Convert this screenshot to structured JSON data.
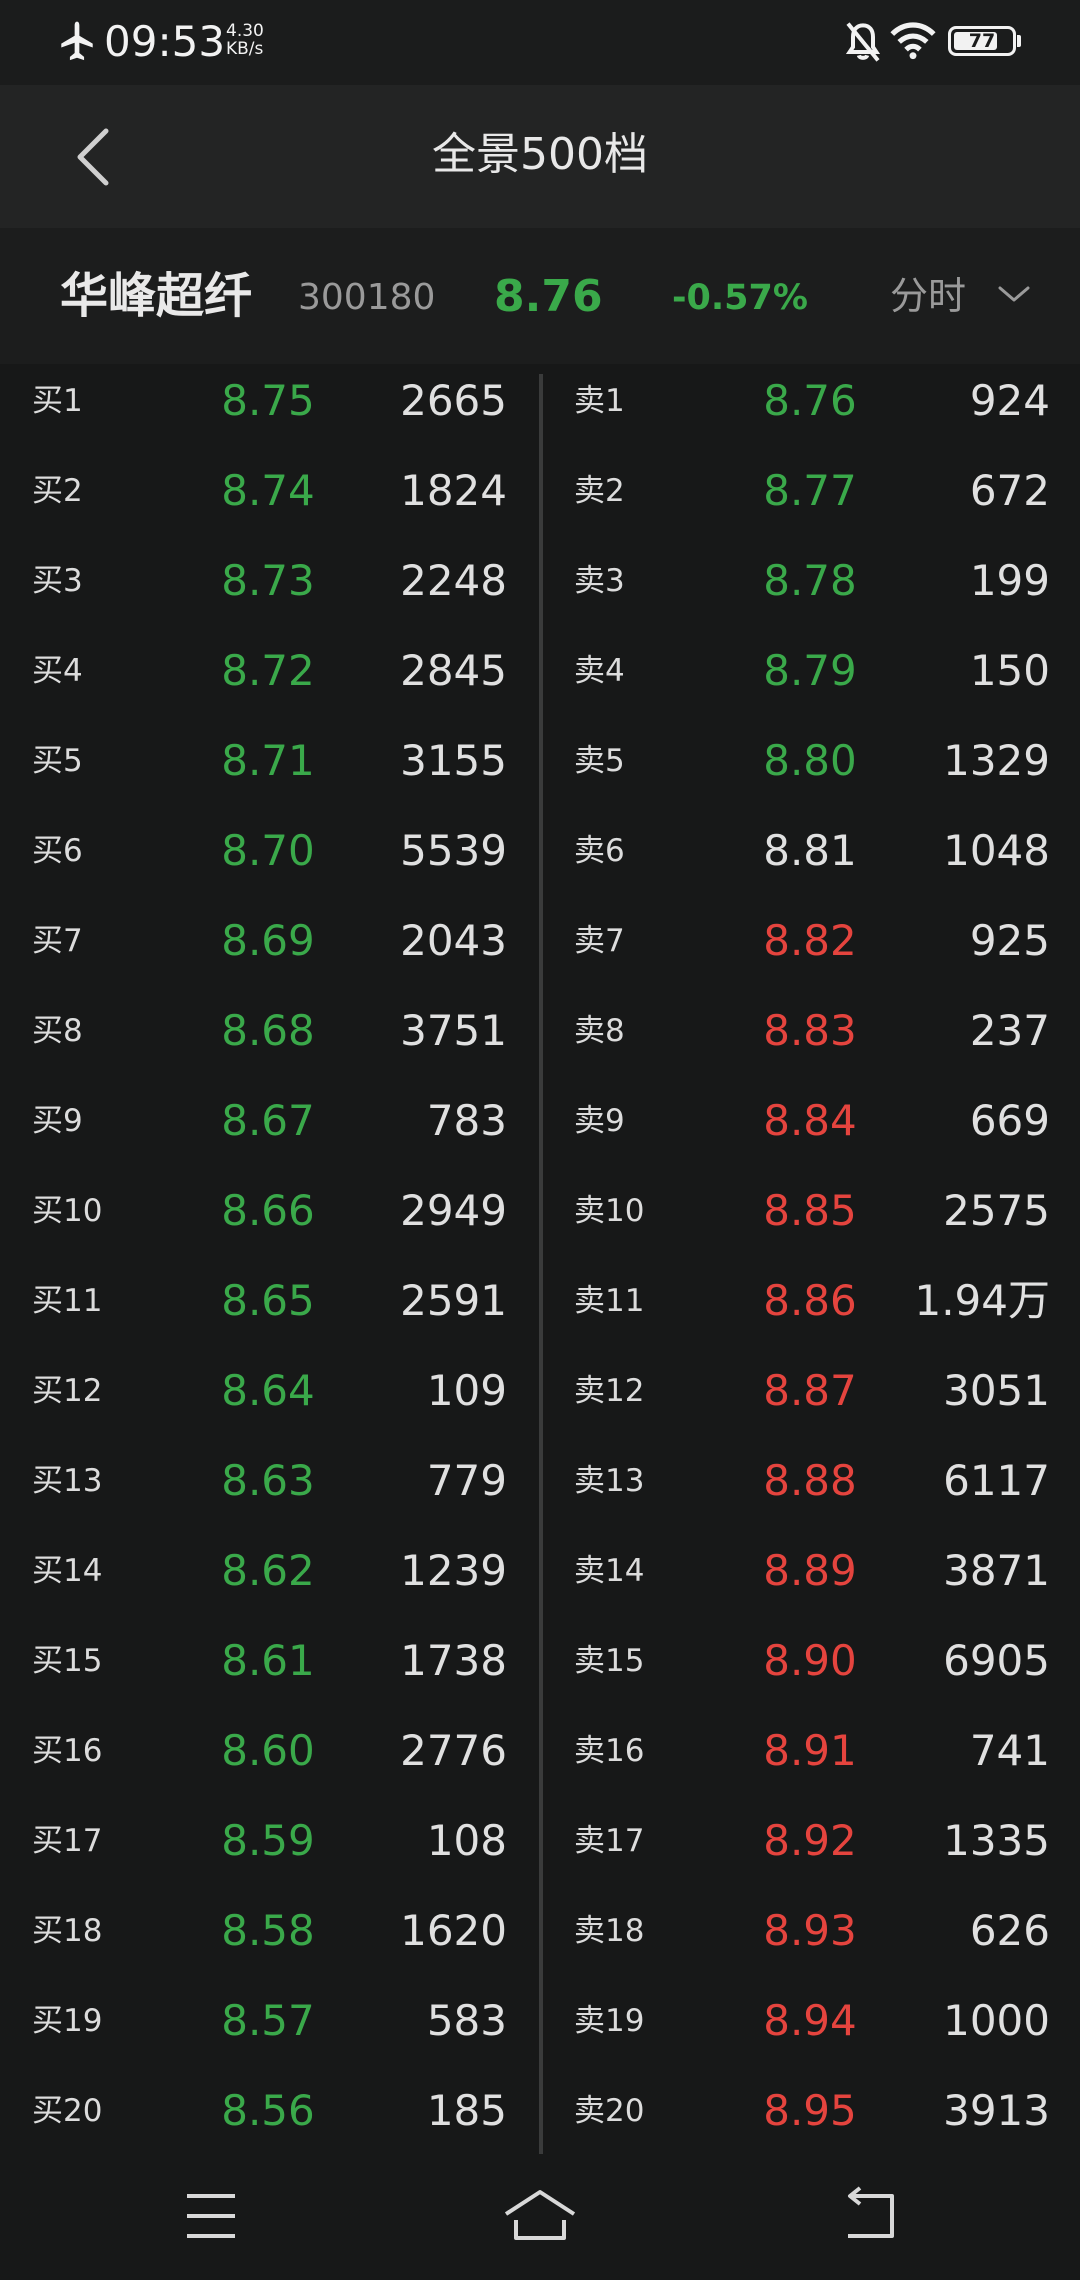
{
  "status_bar": {
    "time": "09:53",
    "net_speed_value": "4.30",
    "net_speed_unit": "KB/s",
    "battery": "77",
    "battery_level": 0.77,
    "icons": [
      "airplane-mode-icon",
      "notifications-muted-icon",
      "wifi-icon",
      "battery-icon"
    ]
  },
  "header": {
    "title": "全景500档",
    "back_icon": "chevron-left-icon"
  },
  "stock": {
    "name": "华峰超纤",
    "code": "300180",
    "price": "8.76",
    "change_pct": "-0.57%",
    "period": "分时",
    "period_icon": "chevron-down-icon"
  },
  "colors": {
    "down_green": "#3aa94a",
    "up_red": "#e5443e",
    "neutral": "#e0e0e0"
  },
  "bids": [
    {
      "label": "买1",
      "price": "8.75",
      "volume": "2665",
      "dir": "down"
    },
    {
      "label": "买2",
      "price": "8.74",
      "volume": "1824",
      "dir": "down"
    },
    {
      "label": "买3",
      "price": "8.73",
      "volume": "2248",
      "dir": "down"
    },
    {
      "label": "买4",
      "price": "8.72",
      "volume": "2845",
      "dir": "down"
    },
    {
      "label": "买5",
      "price": "8.71",
      "volume": "3155",
      "dir": "down"
    },
    {
      "label": "买6",
      "price": "8.70",
      "volume": "5539",
      "dir": "down"
    },
    {
      "label": "买7",
      "price": "8.69",
      "volume": "2043",
      "dir": "down"
    },
    {
      "label": "买8",
      "price": "8.68",
      "volume": "3751",
      "dir": "down"
    },
    {
      "label": "买9",
      "price": "8.67",
      "volume": "783",
      "dir": "down"
    },
    {
      "label": "买10",
      "price": "8.66",
      "volume": "2949",
      "dir": "down"
    },
    {
      "label": "买11",
      "price": "8.65",
      "volume": "2591",
      "dir": "down"
    },
    {
      "label": "买12",
      "price": "8.64",
      "volume": "109",
      "dir": "down"
    },
    {
      "label": "买13",
      "price": "8.63",
      "volume": "779",
      "dir": "down"
    },
    {
      "label": "买14",
      "price": "8.62",
      "volume": "1239",
      "dir": "down"
    },
    {
      "label": "买15",
      "price": "8.61",
      "volume": "1738",
      "dir": "down"
    },
    {
      "label": "买16",
      "price": "8.60",
      "volume": "2776",
      "dir": "down"
    },
    {
      "label": "买17",
      "price": "8.59",
      "volume": "108",
      "dir": "down"
    },
    {
      "label": "买18",
      "price": "8.58",
      "volume": "1620",
      "dir": "down"
    },
    {
      "label": "买19",
      "price": "8.57",
      "volume": "583",
      "dir": "down"
    },
    {
      "label": "买20",
      "price": "8.56",
      "volume": "185",
      "dir": "down"
    }
  ],
  "asks": [
    {
      "label": "卖1",
      "price": "8.76",
      "volume": "924",
      "dir": "down"
    },
    {
      "label": "卖2",
      "price": "8.77",
      "volume": "672",
      "dir": "down"
    },
    {
      "label": "卖3",
      "price": "8.78",
      "volume": "199",
      "dir": "down"
    },
    {
      "label": "卖4",
      "price": "8.79",
      "volume": "150",
      "dir": "down"
    },
    {
      "label": "卖5",
      "price": "8.80",
      "volume": "1329",
      "dir": "down"
    },
    {
      "label": "卖6",
      "price": "8.81",
      "volume": "1048",
      "dir": "flat"
    },
    {
      "label": "卖7",
      "price": "8.82",
      "volume": "925",
      "dir": "up"
    },
    {
      "label": "卖8",
      "price": "8.83",
      "volume": "237",
      "dir": "up"
    },
    {
      "label": "卖9",
      "price": "8.84",
      "volume": "669",
      "dir": "up"
    },
    {
      "label": "卖10",
      "price": "8.85",
      "volume": "2575",
      "dir": "up"
    },
    {
      "label": "卖11",
      "price": "8.86",
      "volume": "1.94万",
      "dir": "up"
    },
    {
      "label": "卖12",
      "price": "8.87",
      "volume": "3051",
      "dir": "up"
    },
    {
      "label": "卖13",
      "price": "8.88",
      "volume": "6117",
      "dir": "up"
    },
    {
      "label": "卖14",
      "price": "8.89",
      "volume": "3871",
      "dir": "up"
    },
    {
      "label": "卖15",
      "price": "8.90",
      "volume": "6905",
      "dir": "up"
    },
    {
      "label": "卖16",
      "price": "8.91",
      "volume": "741",
      "dir": "up"
    },
    {
      "label": "卖17",
      "price": "8.92",
      "volume": "1335",
      "dir": "up"
    },
    {
      "label": "卖18",
      "price": "8.93",
      "volume": "626",
      "dir": "up"
    },
    {
      "label": "卖19",
      "price": "8.94",
      "volume": "1000",
      "dir": "up"
    },
    {
      "label": "卖20",
      "price": "8.95",
      "volume": "3913",
      "dir": "up"
    }
  ],
  "bottom_nav": {
    "icons": [
      "menu-icon",
      "home-icon",
      "back-icon"
    ]
  }
}
